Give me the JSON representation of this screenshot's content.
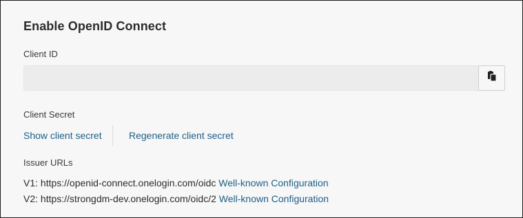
{
  "section": {
    "title": "Enable OpenID Connect"
  },
  "client_id": {
    "label": "Client ID",
    "value": "",
    "copy_icon": "clipboard-icon"
  },
  "client_secret": {
    "label": "Client Secret",
    "show_label": "Show client secret",
    "regenerate_label": "Regenerate client secret"
  },
  "issuer_urls": {
    "label": "Issuer URLs",
    "items": [
      {
        "prefix": "V1: https://openid-connect.onelogin.com/oidc",
        "link_label": "Well-known Configuration"
      },
      {
        "prefix": "V2: https://strongdm-dev.onelogin.com/oidc/2",
        "link_label": "Well-known Configuration"
      }
    ]
  },
  "colors": {
    "link": "#1d5e87",
    "panel_background": "#f7f7f7",
    "input_background": "#ececec"
  }
}
